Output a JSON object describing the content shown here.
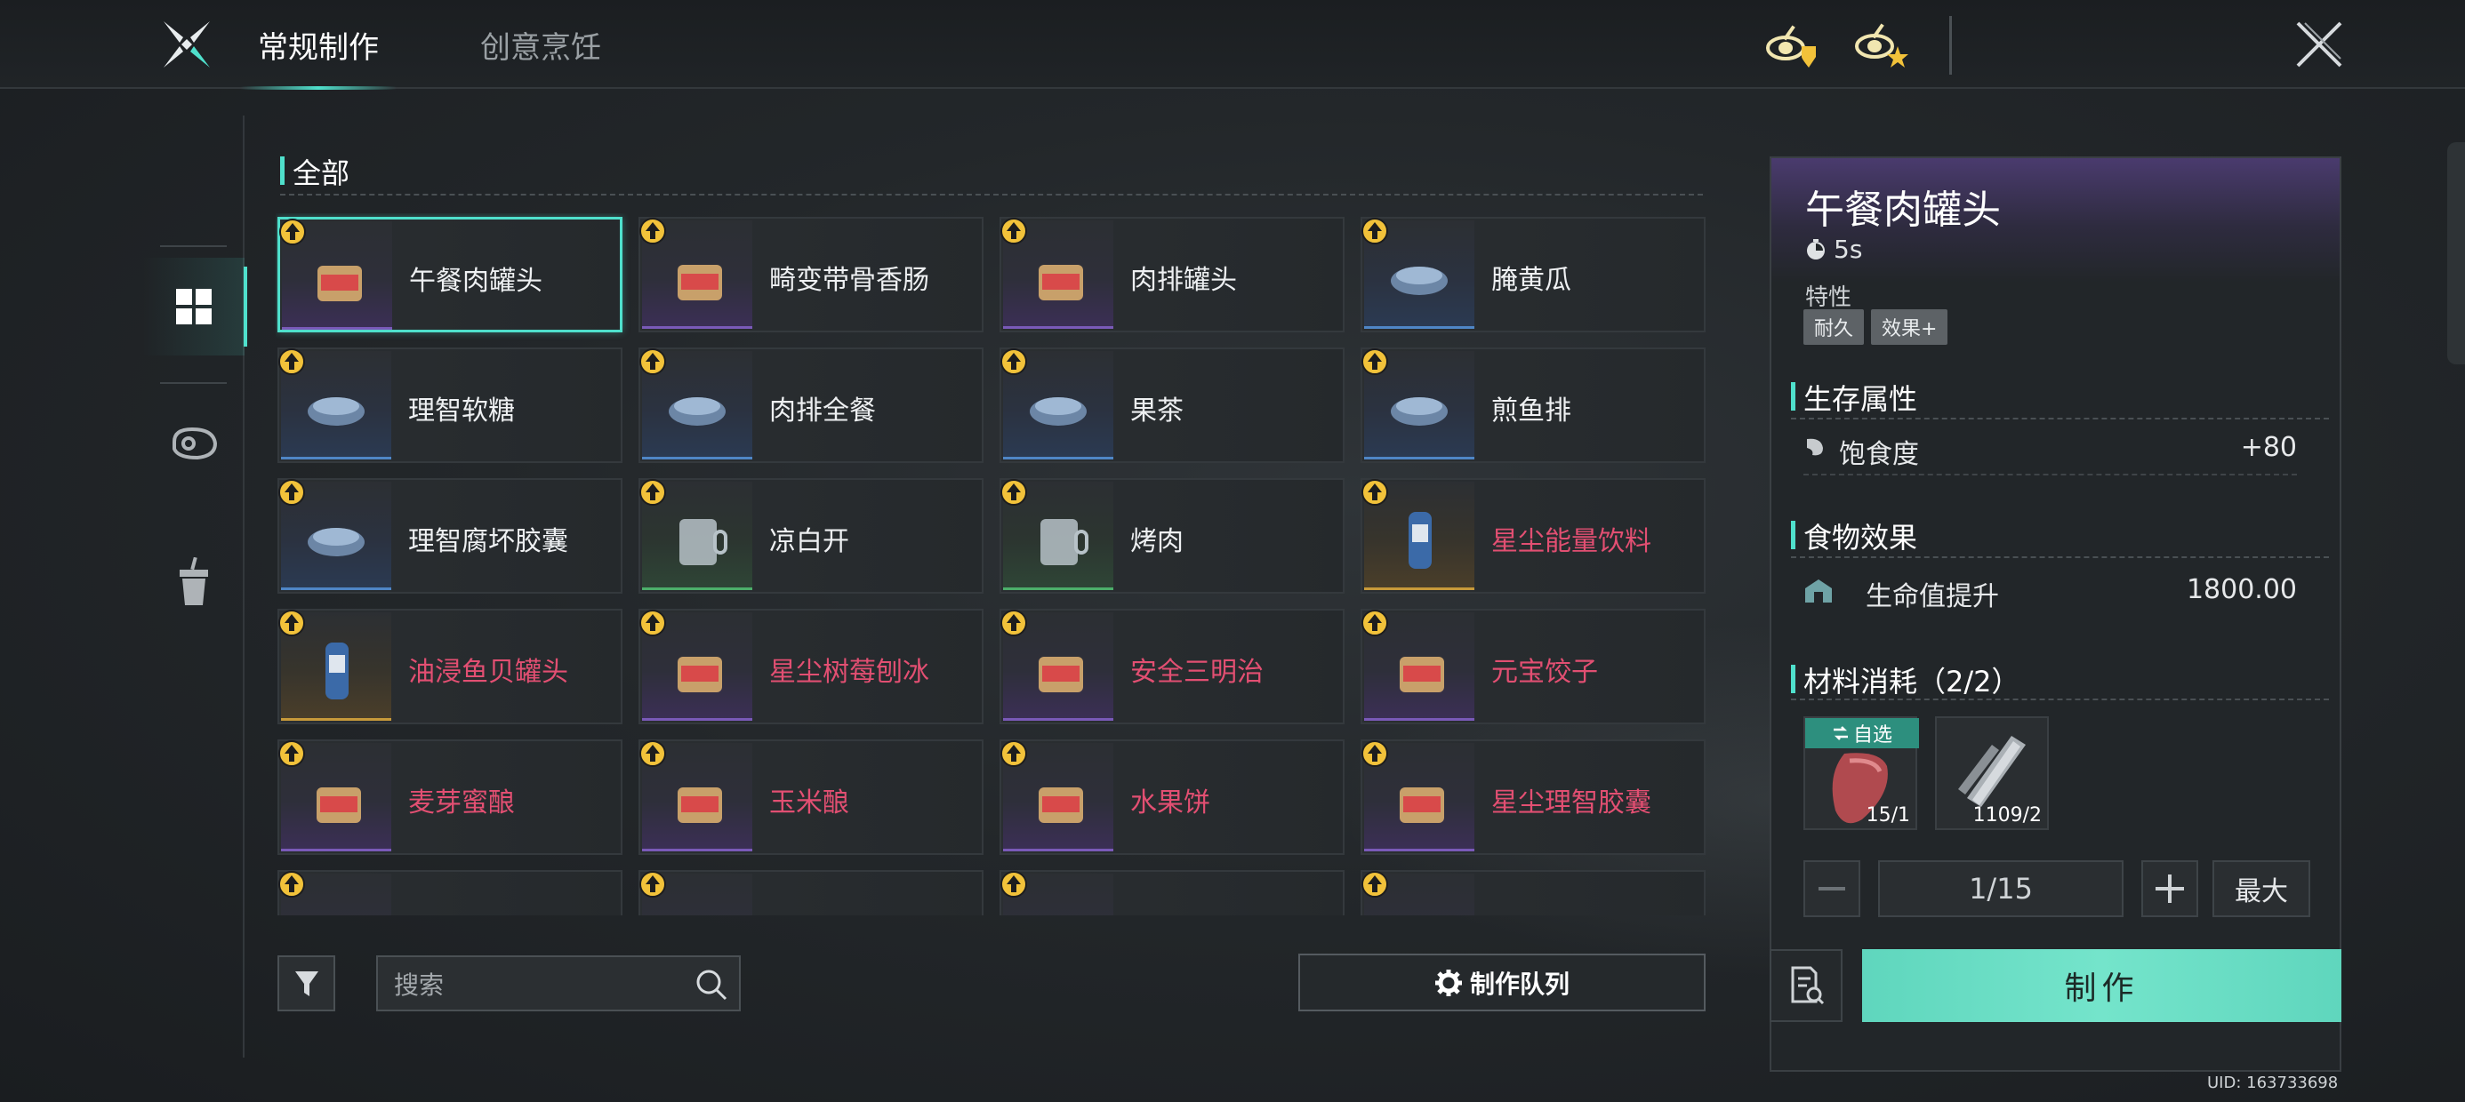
{
  "header": {
    "tabs": [
      {
        "label": "常规制作",
        "active": true
      },
      {
        "label": "创意烹饪",
        "active": false
      }
    ],
    "icons": [
      "chef-guard-icon",
      "chef-star-icon",
      "close-icon"
    ]
  },
  "sidebar": {
    "categories": [
      {
        "icon": "grid-icon",
        "active": true
      },
      {
        "icon": "meat-icon",
        "active": false
      },
      {
        "icon": "drink-cup-icon",
        "active": false
      }
    ]
  },
  "list": {
    "section_title": "全部",
    "items": [
      {
        "name": "午餐肉罐头",
        "rarity": "purple",
        "red": false,
        "icon": "spam-can-icon",
        "selected": true
      },
      {
        "name": "畸变带骨香肠",
        "rarity": "purple",
        "red": false,
        "icon": "bone-sausage-icon"
      },
      {
        "name": "肉排罐头",
        "rarity": "purple",
        "red": false,
        "icon": "steak-can-icon"
      },
      {
        "name": "腌黄瓜",
        "rarity": "blue",
        "red": false,
        "icon": "pickle-jar-icon"
      },
      {
        "name": "理智软糖",
        "rarity": "blue",
        "red": false,
        "icon": "capsule-candy-icon"
      },
      {
        "name": "肉排全餐",
        "rarity": "blue",
        "red": false,
        "icon": "steak-meal-icon"
      },
      {
        "name": "果茶",
        "rarity": "blue",
        "red": false,
        "icon": "fruit-tea-icon"
      },
      {
        "name": "煎鱼排",
        "rarity": "blue",
        "red": false,
        "icon": "fish-fillet-icon"
      },
      {
        "name": "理智腐坏胶囊",
        "rarity": "blue",
        "red": false,
        "icon": "spoiled-capsule-icon"
      },
      {
        "name": "凉白开",
        "rarity": "green",
        "red": false,
        "icon": "water-mug-icon"
      },
      {
        "name": "烤肉",
        "rarity": "green",
        "red": false,
        "icon": "roast-meat-icon"
      },
      {
        "name": "星尘能量饮料",
        "rarity": "gold",
        "red": true,
        "icon": "energy-drink-icon"
      },
      {
        "name": "油浸鱼贝罐头",
        "rarity": "gold",
        "red": true,
        "icon": "oil-fish-can-icon"
      },
      {
        "name": "星尘树莓刨冰",
        "rarity": "purple",
        "red": true,
        "icon": "raspberry-ice-icon"
      },
      {
        "name": "安全三明治",
        "rarity": "purple",
        "red": true,
        "icon": "sandwich-icon"
      },
      {
        "name": "元宝饺子",
        "rarity": "purple",
        "red": true,
        "icon": "dumplings-icon"
      },
      {
        "name": "麦芽蜜酿",
        "rarity": "purple",
        "red": true,
        "icon": "beer-mug-icon"
      },
      {
        "name": "玉米酿",
        "rarity": "purple",
        "red": true,
        "icon": "corn-wine-icon"
      },
      {
        "name": "水果饼",
        "rarity": "purple",
        "red": true,
        "icon": "fruit-pie-icon"
      },
      {
        "name": "星尘理智胶囊",
        "rarity": "purple",
        "red": true,
        "icon": "stardust-capsule-icon"
      },
      {
        "name": "",
        "rarity": "purple",
        "red": true,
        "icon": "item-icon"
      },
      {
        "name": "",
        "rarity": "purple",
        "red": true,
        "icon": "item-icon"
      },
      {
        "name": "",
        "rarity": "purple",
        "red": true,
        "icon": "item-icon"
      },
      {
        "name": "",
        "rarity": "purple",
        "red": true,
        "icon": "item-icon"
      }
    ]
  },
  "bottom": {
    "search_placeholder": "搜索",
    "queue_label": "制作队列"
  },
  "detail": {
    "title": "午餐肉罐头",
    "time": "5s",
    "trait_label": "特性",
    "trait_tags": [
      "耐久",
      "效果+"
    ],
    "survival_title": "生存属性",
    "survival_stats": [
      {
        "label": "饱食度",
        "value": "+80",
        "icon": "stomach-icon"
      }
    ],
    "food_effect_title": "食物效果",
    "food_effects": [
      {
        "label": "生命值提升",
        "value": "1800.00",
        "icon": "shelter-icon"
      }
    ],
    "materials_title": "材料消耗（2/2）",
    "materials": [
      {
        "icon": "raw-meat-icon",
        "count": "15/1",
        "auto_label": "自选"
      },
      {
        "icon": "tin-plate-icon",
        "count": "1109/2"
      }
    ],
    "quantity": "1/15",
    "max_label": "最大",
    "craft_label": "制作"
  },
  "uid": "UID: 163733698",
  "colors": {
    "accent": "#4fe0cc",
    "craft_button": "#6fdfc6",
    "rare_text": "#e24f72",
    "purple": "#7a5ab8",
    "blue": "#4f86c6",
    "green": "#4caf6a",
    "gold": "#c89a3a"
  }
}
